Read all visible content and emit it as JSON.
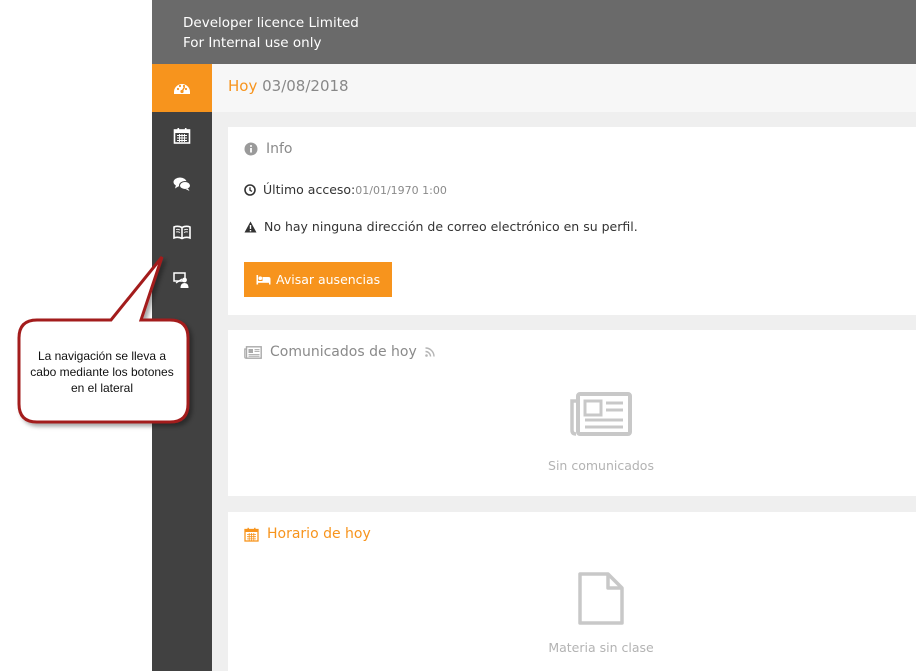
{
  "header": {
    "line1": "Developer licence Limited",
    "line2": "For Internal use only"
  },
  "sidebar": {
    "items": [
      {
        "icon": "dashboard-icon",
        "active": true
      },
      {
        "icon": "calendar-icon",
        "active": false
      },
      {
        "icon": "comments-icon",
        "active": false
      },
      {
        "icon": "book-icon",
        "active": false
      },
      {
        "icon": "teacher-icon",
        "active": false
      }
    ]
  },
  "date_bar": {
    "label": "Hoy",
    "date": "03/08/2018"
  },
  "info_card": {
    "title": "Info",
    "last_access_label": "Último acceso:",
    "last_access_value": "01/01/1970 1:00",
    "warning": "No hay ninguna dirección de correo electrónico en su perfil.",
    "button_label": "Avisar ausencias"
  },
  "comunicados_card": {
    "title": "Comunicados de hoy",
    "empty_text": "Sin comunicados"
  },
  "horario_card": {
    "title": "Horario de hoy",
    "empty_text": "Materia sin clase"
  },
  "callout": {
    "text": "La navigación se lleva a cabo mediante los botones en el lateral"
  },
  "colors": {
    "accent": "#f7941d",
    "sidebar": "#414141",
    "topbar": "#6a6a6a",
    "callout_border": "#a31a1a"
  }
}
